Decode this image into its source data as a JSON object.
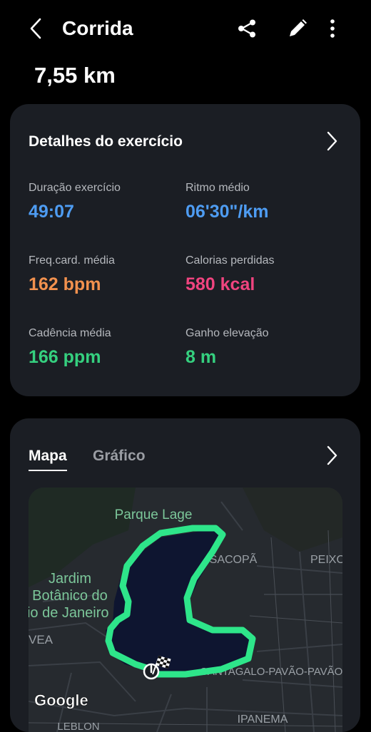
{
  "header": {
    "title": "Corrida",
    "back_icon": "chevron-left-icon",
    "share_icon": "share-icon",
    "edit_icon": "pencil-icon",
    "more_icon": "more-vertical-icon"
  },
  "summary": {
    "distance": "7,55 km"
  },
  "details": {
    "title": "Detalhes do exercício",
    "stats": [
      {
        "label": "Duração exercício",
        "value": "49:07",
        "color": "#4e9cf2"
      },
      {
        "label": "Ritmo médio",
        "value": "06'30\"/km",
        "color": "#4e9cf2"
      },
      {
        "label": "Freq.card. média",
        "value": "162 bpm",
        "color": "#f2914e"
      },
      {
        "label": "Calorias perdidas",
        "value": "580 kcal",
        "color": "#f0447f"
      },
      {
        "label": "Cadência média",
        "value": "166 ppm",
        "color": "#35d07f"
      },
      {
        "label": "Ganho elevação",
        "value": "8 m",
        "color": "#35d07f"
      }
    ]
  },
  "map_section": {
    "tabs": [
      "Mapa",
      "Gráfico"
    ],
    "active_tab": "Mapa",
    "map_labels": {
      "parque_lage": "Parque Lage",
      "sacopa": "SACOPÃ",
      "peixoto": "PEIXO",
      "jardim_line1": "Jardim",
      "jardim_line2": "Botânico do",
      "jardim_line3": "Rio de Janeiro",
      "gavea": "VEA",
      "cantagalo": "CANTAGALO-PAVÃO-PAVÃO",
      "ipanema": "IPANEMA",
      "leblon": "LEBLON",
      "google": "Google"
    },
    "route_color": "#2ee58a",
    "start_icon": "power-start-icon",
    "finish_icon": "checkered-flag-icon"
  }
}
